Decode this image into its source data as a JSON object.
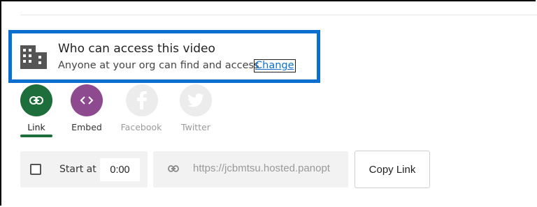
{
  "access": {
    "title": "Who can access this video",
    "subtitle": "Anyone at your org can find and access",
    "change_label": "Change"
  },
  "share": {
    "items": [
      {
        "label": "Link",
        "icon": "link-icon",
        "color": "#1e6e3c",
        "active": true
      },
      {
        "label": "Embed",
        "icon": "code-icon",
        "color": "#8e4a8e",
        "active": false
      },
      {
        "label": "Facebook",
        "icon": "facebook-icon",
        "color": "#ececec",
        "active": false
      },
      {
        "label": "Twitter",
        "icon": "twitter-icon",
        "color": "#ececec",
        "active": false
      }
    ]
  },
  "start_at": {
    "label": "Start at",
    "value": "0:00",
    "checked": false
  },
  "link": {
    "url": "https://jcbmtsu.hosted.panopt",
    "copy_label": "Copy Link"
  },
  "colors": {
    "highlight": "#0b6fd0",
    "link_active": "#1e6e3c",
    "embed": "#8e4a8e",
    "disabled_social": "#ececec"
  }
}
